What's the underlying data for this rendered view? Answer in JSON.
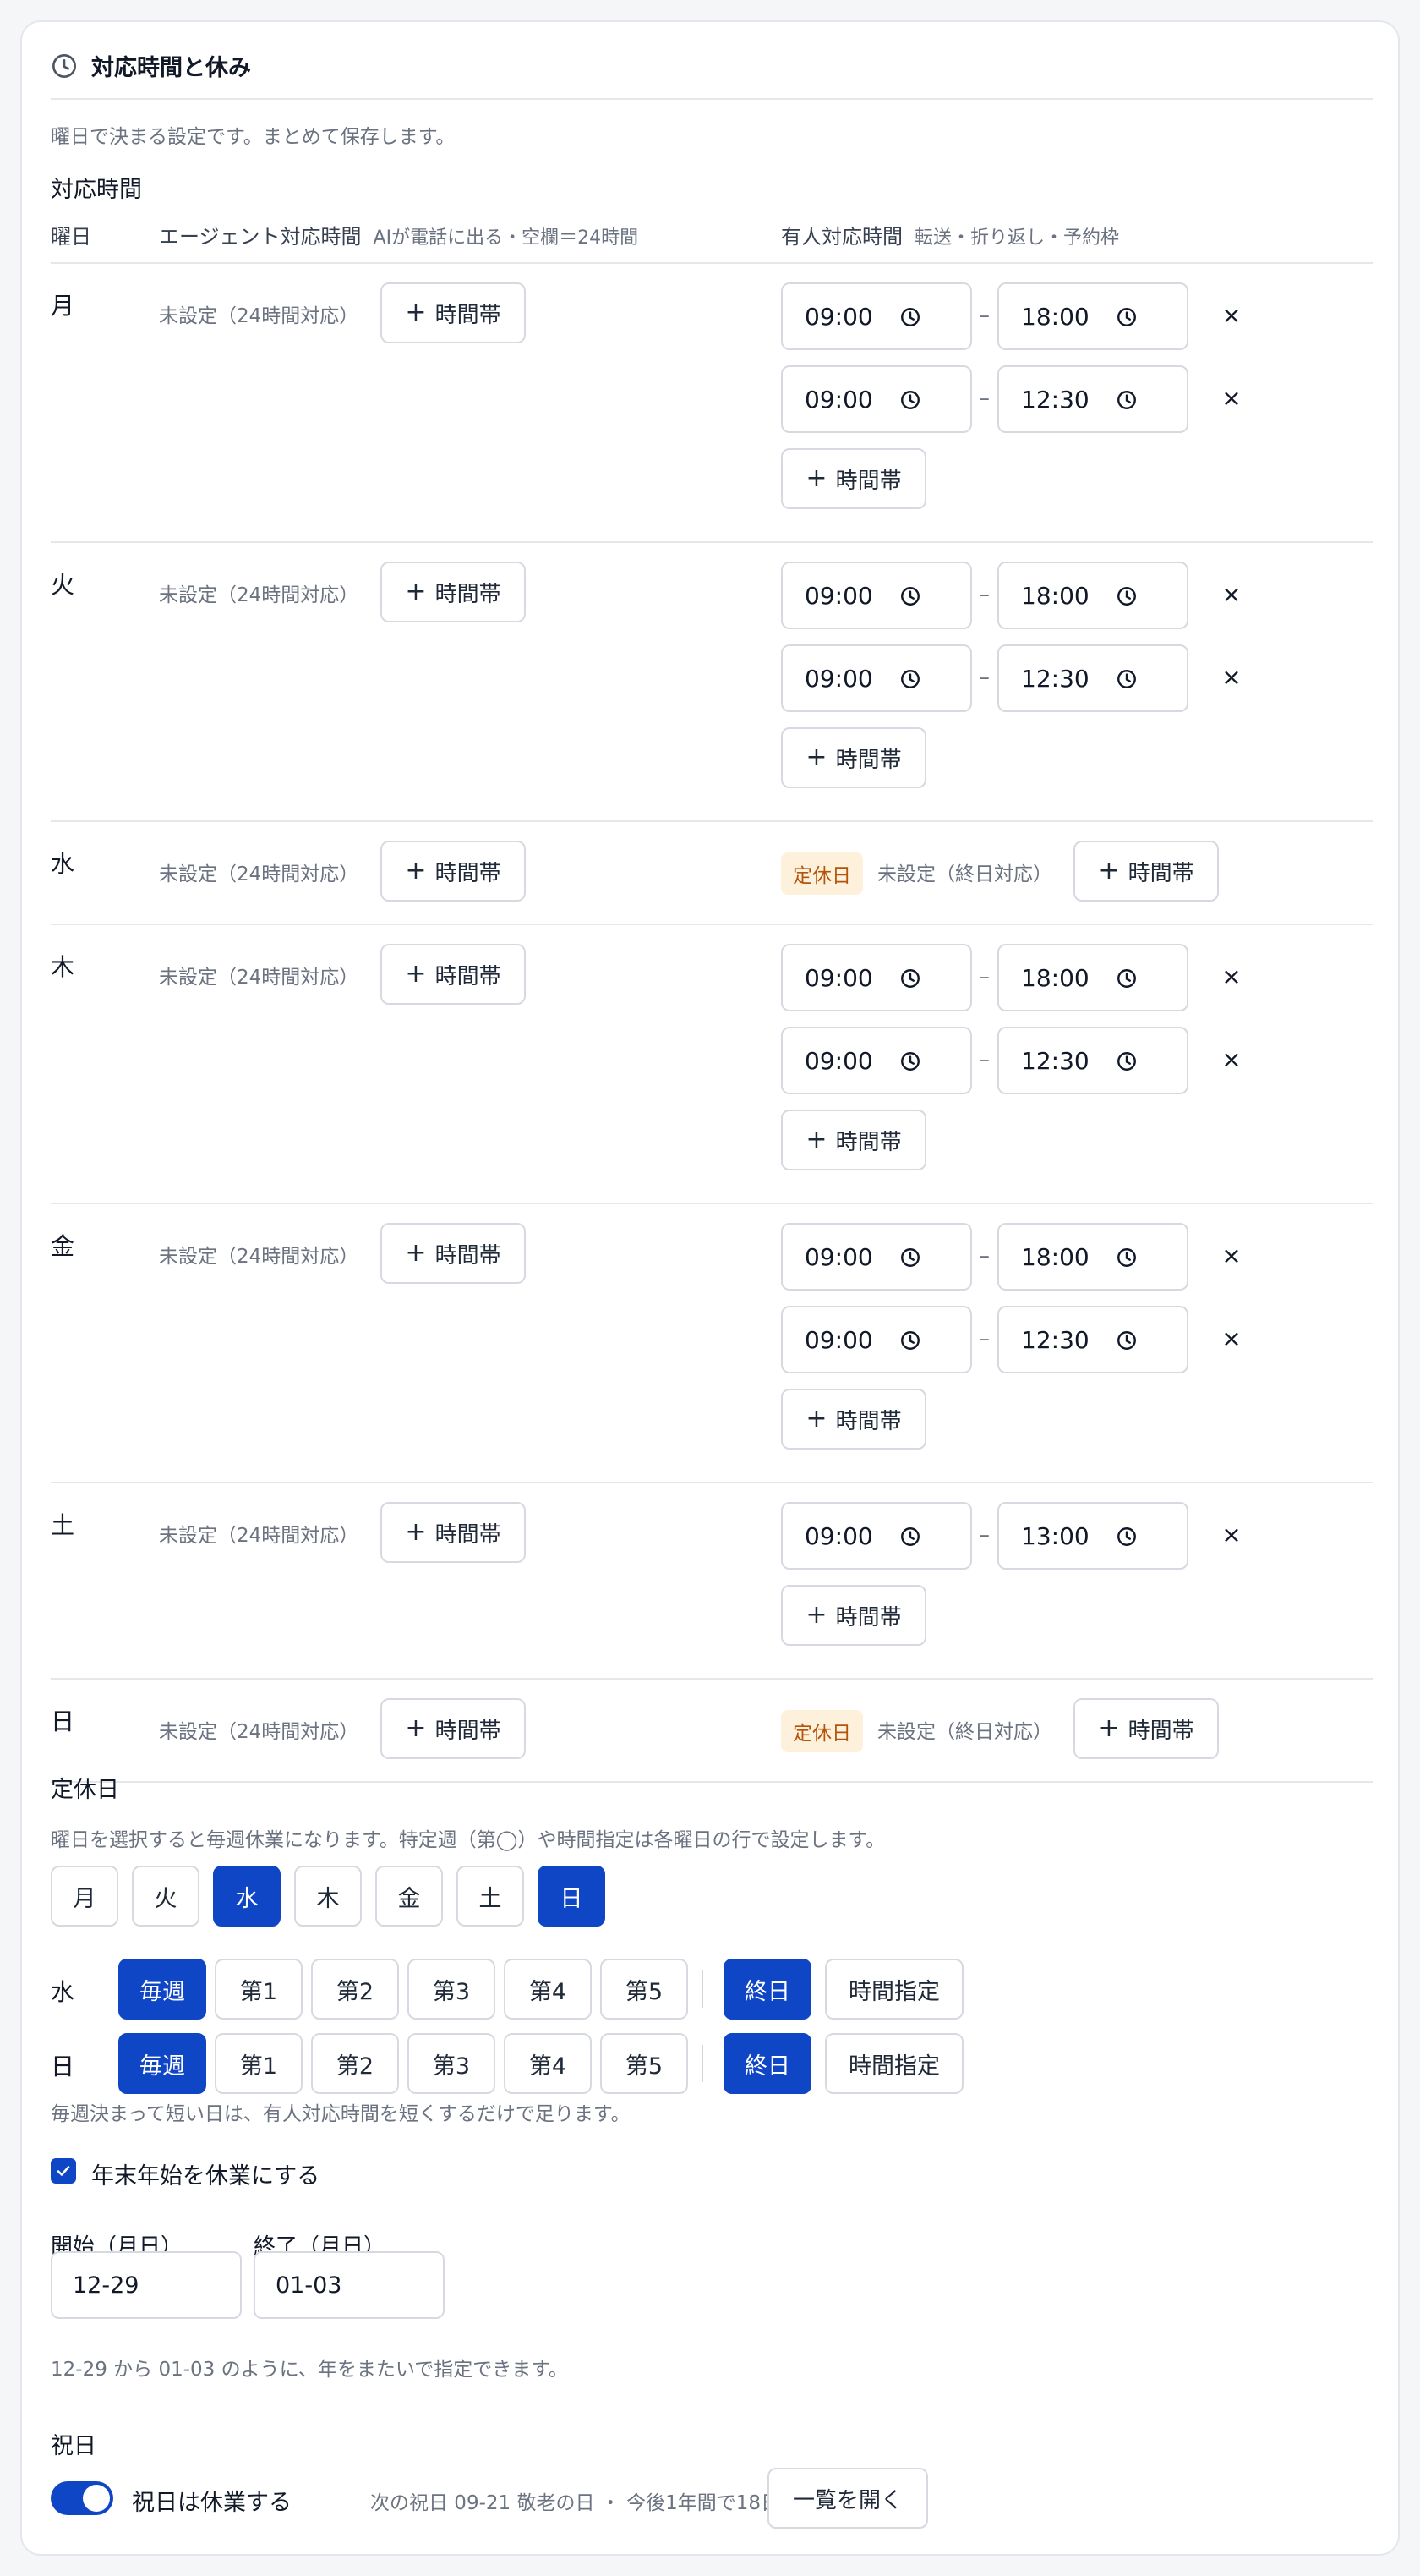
{
  "header": {
    "title": "対応時間と休み"
  },
  "description": "曜日で決まる設定です。まとめて保存します。",
  "hours": {
    "title": "対応時間",
    "col_day": "曜日",
    "col_agent": "エージェント対応時間",
    "col_agent_sub": "AIが電話に出る・空欄＝24時間",
    "col_human": "有人対応時間",
    "col_human_sub": "転送・折り返し・予約枠",
    "agent_unset": "未設定（24時間対応）",
    "add_slot": "時間帯",
    "closed_badge": "定休日",
    "human_unset": "未設定（終日対応）",
    "days": [
      {
        "name": "月",
        "slots": [
          [
            "09:00",
            "18:00"
          ],
          [
            "09:00",
            "12:30"
          ]
        ]
      },
      {
        "name": "火",
        "slots": [
          [
            "09:00",
            "18:00"
          ],
          [
            "09:00",
            "12:30"
          ]
        ]
      },
      {
        "name": "水",
        "slots": []
      },
      {
        "name": "木",
        "slots": [
          [
            "09:00",
            "18:00"
          ],
          [
            "09:00",
            "12:30"
          ]
        ]
      },
      {
        "name": "金",
        "slots": [
          [
            "09:00",
            "18:00"
          ],
          [
            "09:00",
            "12:30"
          ]
        ]
      },
      {
        "name": "土",
        "slots": [
          [
            "09:00",
            "13:00"
          ]
        ]
      },
      {
        "name": "日",
        "slots": []
      }
    ]
  },
  "closed": {
    "title": "定休日",
    "desc": "曜日を選択すると毎週休業になります。特定週（第◯）や時間指定は各曜日の行で設定します。",
    "weekdays": [
      {
        "label": "月",
        "selected": false
      },
      {
        "label": "火",
        "selected": false
      },
      {
        "label": "水",
        "selected": true
      },
      {
        "label": "木",
        "selected": false
      },
      {
        "label": "金",
        "selected": false
      },
      {
        "label": "土",
        "selected": false
      },
      {
        "label": "日",
        "selected": true
      }
    ],
    "rules": [
      {
        "day": "水",
        "week_options": [
          "毎週",
          "第1",
          "第2",
          "第3",
          "第4",
          "第5"
        ],
        "week_selected": "毎週",
        "time_options": [
          "終日",
          "時間指定"
        ],
        "time_selected": "終日"
      },
      {
        "day": "日",
        "week_options": [
          "毎週",
          "第1",
          "第2",
          "第3",
          "第4",
          "第5"
        ],
        "week_selected": "毎週",
        "time_options": [
          "終日",
          "時間指定"
        ],
        "time_selected": "終日"
      }
    ],
    "note": "毎週決まって短い日は、有人対応時間を短くするだけで足ります。"
  },
  "new_year": {
    "checkbox_label": "年末年始を休業にする",
    "checked": true,
    "start_label": "開始（月日）",
    "end_label": "終了（月日）",
    "start_value": "12-29",
    "end_value": "01-03",
    "hint": "12-29 から 01-03 のように、年をまたいで指定できます。"
  },
  "holidays": {
    "title": "祝日",
    "toggle_label": "祝日は休業する",
    "toggle_on": true,
    "next_info": "次の祝日 09-21 敬老の日 ・ 今後1年間で18日",
    "open_list": "一覧を開く"
  },
  "colors": {
    "accent": "#0f46c6",
    "badge_bg": "#fdf1dc",
    "badge_text": "#b45309"
  }
}
